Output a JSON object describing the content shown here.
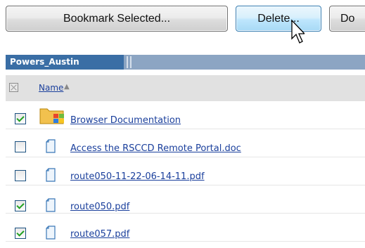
{
  "toolbar": {
    "bookmark_label": "Bookmark Selected...",
    "delete_label": "Delete...",
    "partial_label": "Do"
  },
  "tab": {
    "label": "Powers_Austin"
  },
  "table": {
    "header_name": "Name",
    "sort_icon": "sort-ascending-icon",
    "rows": [
      {
        "name": "Browser Documentation",
        "checked": true,
        "icon": "folder-icon"
      },
      {
        "name": "Access the RSCCD Remote Portal.doc",
        "checked": false,
        "icon": "document-icon"
      },
      {
        "name": "route050-11-22-06-14-11.pdf",
        "checked": false,
        "icon": "document-icon"
      },
      {
        "name": "route050.pdf",
        "checked": true,
        "icon": "document-icon"
      },
      {
        "name": "route057.pdf",
        "checked": true,
        "icon": "document-icon"
      }
    ]
  },
  "colors": {
    "link": "#1a3f9c",
    "tab": "#3a6ea5",
    "checkmark": "#21a121"
  }
}
